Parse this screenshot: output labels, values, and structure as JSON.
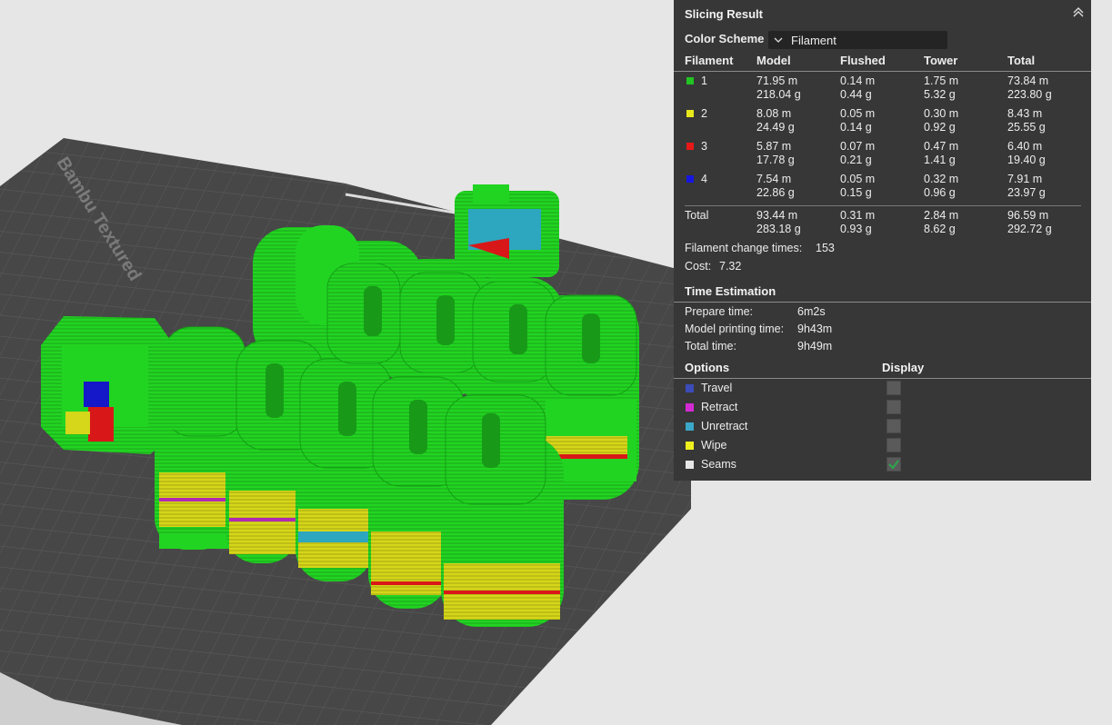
{
  "viewport": {
    "bed_label": "Bambu Textured",
    "colors": {
      "background": "#e6e6e6",
      "bed": "#474747",
      "grid": "#5e5e5e",
      "model_green": "#22d422",
      "model_yellow": "#d6d61a",
      "model_red": "#d81818",
      "model_blue": "#1418c8",
      "arrow": "#ee2222"
    }
  },
  "panel": {
    "title": "Slicing Result",
    "color_scheme": {
      "label": "Color Scheme",
      "value": "Filament"
    },
    "columns": [
      "Filament",
      "Model",
      "Flushed",
      "Tower",
      "Total"
    ],
    "rows": [
      {
        "id": "1",
        "color": "#22c322",
        "model": [
          "71.95 m",
          "218.04 g"
        ],
        "flushed": [
          "0.14 m",
          "0.44 g"
        ],
        "tower": [
          "1.75 m",
          "5.32 g"
        ],
        "total": [
          "73.84 m",
          "223.80 g"
        ]
      },
      {
        "id": "2",
        "color": "#e8e81a",
        "model": [
          "8.08 m",
          "24.49 g"
        ],
        "flushed": [
          "0.05 m",
          "0.14 g"
        ],
        "tower": [
          "0.30 m",
          "0.92 g"
        ],
        "total": [
          "8.43 m",
          "25.55 g"
        ]
      },
      {
        "id": "3",
        "color": "#e81818",
        "model": [
          "5.87 m",
          "17.78 g"
        ],
        "flushed": [
          "0.07 m",
          "0.21 g"
        ],
        "tower": [
          "0.47 m",
          "1.41 g"
        ],
        "total": [
          "6.40 m",
          "19.40 g"
        ]
      },
      {
        "id": "4",
        "color": "#1616e0",
        "model": [
          "7.54 m",
          "22.86 g"
        ],
        "flushed": [
          "0.05 m",
          "0.15 g"
        ],
        "tower": [
          "0.32 m",
          "0.96 g"
        ],
        "total": [
          "7.91 m",
          "23.97 g"
        ]
      }
    ],
    "total_row": {
      "label": "Total",
      "model": [
        "93.44 m",
        "283.18 g"
      ],
      "flushed": [
        "0.31 m",
        "0.93 g"
      ],
      "tower": [
        "2.84 m",
        "8.62 g"
      ],
      "total": [
        "96.59 m",
        "292.72 g"
      ]
    },
    "filament_change": {
      "label": "Filament change times:",
      "value": "153"
    },
    "cost": {
      "label": "Cost:",
      "value": "7.32"
    },
    "time_estimation": {
      "title": "Time Estimation",
      "prepare": {
        "label": "Prepare time:",
        "value": "6m2s"
      },
      "model": {
        "label": "Model printing time:",
        "value": "9h43m"
      },
      "total": {
        "label": "Total time:",
        "value": "9h49m"
      }
    },
    "options": {
      "header": "Options",
      "display_header": "Display",
      "items": [
        {
          "label": "Travel",
          "color": "#3b4cb8",
          "checked": false
        },
        {
          "label": "Retract",
          "color": "#d42ad4",
          "checked": false
        },
        {
          "label": "Unretract",
          "color": "#3aa8c8",
          "checked": false
        },
        {
          "label": "Wipe",
          "color": "#f0f01e",
          "checked": false
        },
        {
          "label": "Seams",
          "color": "#e6e6e6",
          "checked": true
        }
      ]
    }
  }
}
